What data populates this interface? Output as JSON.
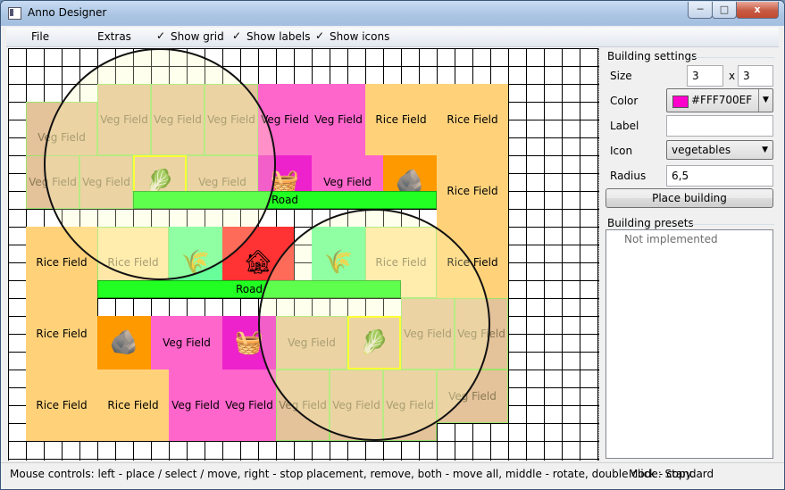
{
  "window": {
    "title": "Anno Designer",
    "min_glyph": "─",
    "max_glyph": "□",
    "close_glyph": "x"
  },
  "menu": {
    "file": "File",
    "extras": "Extras",
    "show_grid": "Show grid",
    "show_labels": "Show labels",
    "show_icons": "Show icons",
    "check_glyph": "✓"
  },
  "canvas": {
    "labels": {
      "veg": "Veg Field",
      "rice": "Rice Field",
      "road": "Road"
    },
    "colors": {
      "veg": "#ff66cc",
      "rice": "#ffd27a",
      "road": "#22ff22",
      "orange": "#ff9900",
      "green_icon": "#66ff99",
      "red": "#ff3333",
      "magenta": "#ee22cc",
      "highlight_veg": "#e4c29a",
      "highlight_rice": "#ffe7a8",
      "selection": "#ffff00"
    }
  },
  "settings": {
    "group_title": "Building settings",
    "size_label": "Size",
    "size_w": "3",
    "size_x": "x",
    "size_h": "3",
    "color_label": "Color",
    "color_value": "#FFF700EF",
    "color_swatch": "#ff00cc",
    "label_label": "Label",
    "label_value": "",
    "icon_label": "Icon",
    "icon_value": "vegetables",
    "radius_label": "Radius",
    "radius_value": "6,5",
    "place_button": "Place building"
  },
  "presets": {
    "group_title": "Building presets",
    "empty_text": "Not implemented"
  },
  "status": {
    "mouse_controls": "Mouse controls: left - place / select / move, right - stop placement, remove, both - move all, middle - rotate, double click - copy.",
    "mode": "Mode: Standard"
  }
}
